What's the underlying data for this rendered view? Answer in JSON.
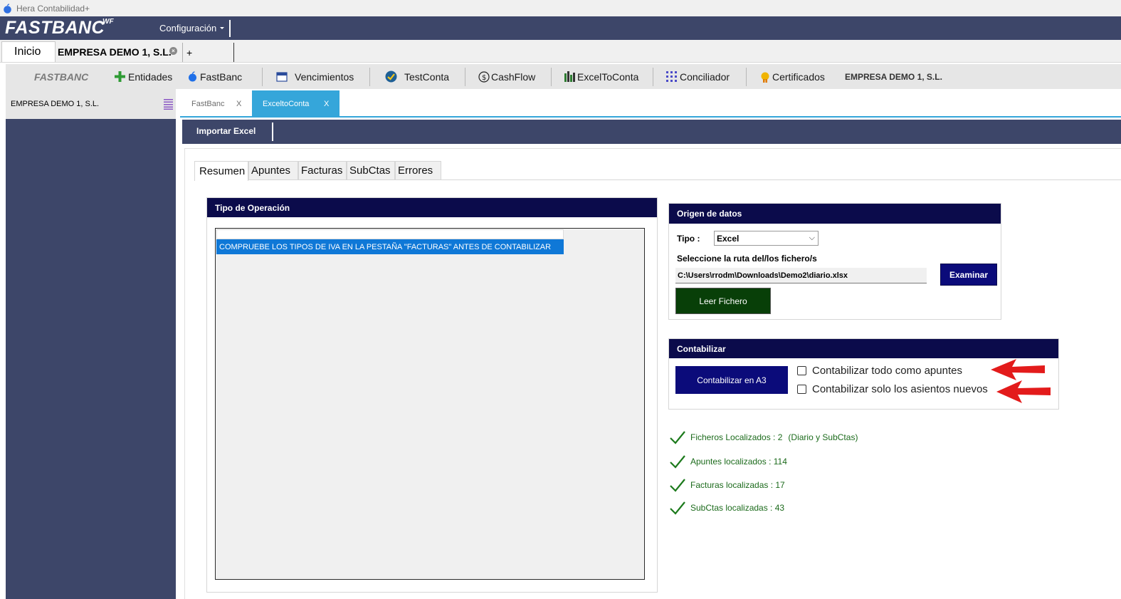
{
  "window": {
    "title": "Hera Contabilidad+"
  },
  "brand": {
    "name": "FASTBANC",
    "superscript": "WF",
    "menu_config": "Configuración"
  },
  "doc_tabs": {
    "inicio": "Inicio",
    "empresa": "EMPRESA DEMO 1, S.L.",
    "plus": "+"
  },
  "toolbar": {
    "logo": "FASTBANC",
    "items": [
      "Entidades",
      "FastBanc",
      "Vencimientos",
      "TestConta",
      "CashFlow",
      "ExcelToConta",
      "Conciliador",
      "Certificados"
    ],
    "company": "EMPRESA DEMO 1, S.L."
  },
  "sidebar": {
    "company": "EMPRESA DEMO 1, S.L."
  },
  "inner_tabs": [
    {
      "label": "FastBanc",
      "close": "X"
    },
    {
      "label": "ExceltoConta",
      "close": "X"
    }
  ],
  "subbar": {
    "importar": "Importar Excel"
  },
  "sub_tabs": [
    "Resumen",
    "Apuntes",
    "Facturas",
    "SubCtas",
    "Errores"
  ],
  "tipo_operacion": {
    "title": "Tipo de Operación",
    "selected_item": "COMPRUEBE LOS TIPOS DE IVA EN LA PESTAÑA \"FACTURAS\" ANTES DE CONTABILIZAR"
  },
  "origen": {
    "title": "Origen de datos",
    "tipo_label": "Tipo :",
    "tipo_value": "Excel",
    "ruta_label": "Seleccione la ruta del/los fichero/s",
    "ruta_value": "C:\\Users\\rrodm\\Downloads\\Demo2\\diario.xlsx",
    "examinar": "Examinar",
    "leer": "Leer Fichero"
  },
  "contabilizar": {
    "title": "Contabilizar",
    "button": "Contabilizar en A3",
    "option1": "Contabilizar todo como apuntes",
    "option2": "Contabilizar solo los asientos nuevos"
  },
  "status": {
    "ficheros": "Ficheros Localizados : 2",
    "ficheros_extra": "(Diario y SubCtas)",
    "apuntes": "Apuntes localizados : 114",
    "facturas": "Facturas localizadas : 17",
    "subctas": "SubCtas localizadas : 43"
  },
  "colors": {
    "navy": "#3d4669",
    "panel_head": "#0b0b4b",
    "accent_blue": "#35a6da",
    "ok_green": "#1c6b1c",
    "arrow_red": "#e31b1b"
  }
}
